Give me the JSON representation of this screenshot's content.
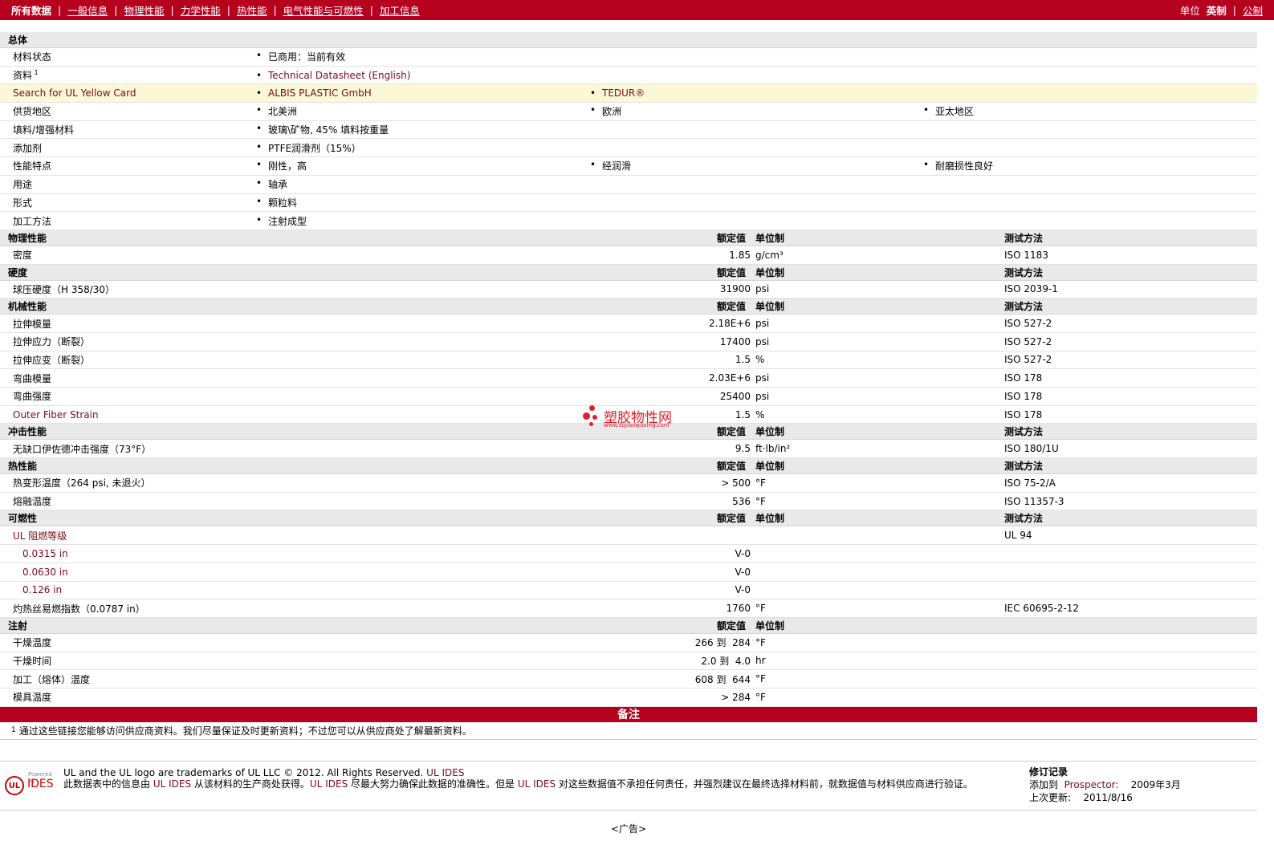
{
  "nav": {
    "items": [
      "所有数据",
      "一般信息",
      "物理性能",
      "力学性能",
      "热性能",
      "电气性能与可燃性",
      "加工信息"
    ],
    "units_label": "单位",
    "unit_current": "英制",
    "unit_other": "公制"
  },
  "general": {
    "title": "总体",
    "rows": [
      {
        "label": "材料状态",
        "values": [
          "已商用：当前有效"
        ]
      },
      {
        "label": "资料",
        "sup": "1",
        "values": [
          "Technical Datasheet (English)"
        ],
        "link": true
      },
      {
        "label": "Search for UL Yellow Card",
        "values": [
          "ALBIS PLASTIC GmbH",
          "TEDUR®"
        ],
        "link": true,
        "highlight": true
      },
      {
        "label": "供货地区",
        "values": [
          "北美洲",
          "欧洲",
          "亚太地区"
        ]
      },
      {
        "label": "填料/增强材料",
        "values": [
          "玻璃\\矿物, 45% 填料按重量"
        ]
      },
      {
        "label": "添加剂",
        "values": [
          "PTFE润滑剂（15%）"
        ]
      },
      {
        "label": "性能特点",
        "values": [
          "刚性，高",
          "经润滑",
          "耐磨损性良好"
        ]
      },
      {
        "label": "用途",
        "values": [
          "轴承"
        ]
      },
      {
        "label": "形式",
        "values": [
          "颗粒料"
        ]
      },
      {
        "label": "加工方法",
        "values": [
          "注射成型"
        ]
      }
    ]
  },
  "headers": {
    "nominal": "额定值",
    "unit": "单位制",
    "method": "测试方法"
  },
  "sections": [
    {
      "title": "物理性能",
      "method_header": true,
      "rows": [
        {
          "label": "密度",
          "value": "1.85",
          "unit": "g/cm³",
          "method": "ISO 1183"
        }
      ]
    },
    {
      "title": "硬度",
      "method_header": true,
      "rows": [
        {
          "label": "球压硬度（H 358/30）",
          "value": "31900",
          "unit": "psi",
          "method": "ISO 2039-1"
        }
      ]
    },
    {
      "title": "机械性能",
      "method_header": true,
      "rows": [
        {
          "label": "拉伸模量",
          "value": "2.18E+6",
          "unit": "psi",
          "method": "ISO 527-2"
        },
        {
          "label": "拉伸应力（断裂）",
          "value": "17400",
          "unit": "psi",
          "method": "ISO 527-2"
        },
        {
          "label": "拉伸应变（断裂）",
          "value": "1.5",
          "unit": "%",
          "method": "ISO 527-2"
        },
        {
          "label": "弯曲模量",
          "value": "2.03E+6",
          "unit": "psi",
          "method": "ISO 178"
        },
        {
          "label": "弯曲强度",
          "value": "25400",
          "unit": "psi",
          "method": "ISO 178"
        },
        {
          "label": "Outer Fiber Strain",
          "value": "1.5",
          "unit": "%",
          "method": "ISO 178",
          "link": true
        }
      ]
    },
    {
      "title": "冲击性能",
      "method_header": true,
      "rows": [
        {
          "label": "无缺口伊佐德冲击强度（73°F）",
          "value": "9.5",
          "unit": "ft·lb/in²",
          "method": "ISO 180/1U"
        }
      ]
    },
    {
      "title": "热性能",
      "method_header": true,
      "rows": [
        {
          "label": "热变形温度（264 psi, 未退火）",
          "value": "> 500",
          "unit": "°F",
          "method": "ISO 75-2/A"
        },
        {
          "label": "熔融温度",
          "value": "536",
          "unit": "°F",
          "method": "ISO 11357-3"
        }
      ]
    },
    {
      "title": "可燃性",
      "method_header": true,
      "rows": [
        {
          "label": "UL 阻燃等级",
          "value": "",
          "unit": "",
          "method": "UL 94",
          "link": true
        },
        {
          "label": "0.0315 in",
          "value": "V-0",
          "unit": "",
          "method": "",
          "sub": true
        },
        {
          "label": "0.0630 in",
          "value": "V-0",
          "unit": "",
          "method": "",
          "sub": true
        },
        {
          "label": "0.126 in",
          "value": "V-0",
          "unit": "",
          "method": "",
          "sub": true
        },
        {
          "label": "灼热丝易燃指数（0.0787 in）",
          "value": "1760",
          "unit": "°F",
          "method": "IEC 60695-2-12"
        }
      ]
    },
    {
      "title": "注射",
      "method_header": false,
      "rows": [
        {
          "label": "干燥温度",
          "value": "266 到  284",
          "unit": "°F",
          "method": ""
        },
        {
          "label": "干燥时间",
          "value": "2.0 到  4.0",
          "unit": "hr",
          "method": ""
        },
        {
          "label": "加工（熔体）温度",
          "value": "608 到  644",
          "unit": "°F",
          "method": ""
        },
        {
          "label": "模具温度",
          "value": "> 284",
          "unit": "°F",
          "method": ""
        }
      ]
    }
  ],
  "notes": {
    "title": "备注",
    "sup": "1",
    "text": "通过这些链接您能够访问供应商资料。我们尽量保证及时更新资料；不过您可以从供应商处了解最新资料。"
  },
  "footer": {
    "powered": "Powered by",
    "ul": "UL",
    "ides": "IDES",
    "line1_pre": "UL and the UL logo are trademarks of UL LLC © 2012. All Rights Reserved. ",
    "line1_link": "UL IDES",
    "line2_a": "此数据表中的信息由 ",
    "line2_b": "UL IDES",
    "line2_c": " 从该材料的生产商处获得。",
    "line2_d": "UL IDES",
    "line2_e": " 尽最大努力确保此数据的准确性。但是 ",
    "line2_f": "UL IDES",
    "line2_g": " 对这些数据值不承担任何责任，并强烈建议在最终选择材料前，就数据值与材料供应商进行验证。",
    "rev_title": "修订记录",
    "rev_added_label": "添加到",
    "rev_added_link": "Prospector:",
    "rev_added_date": "2009年3月",
    "rev_updated_label": "上次更新:",
    "rev_updated_date": "2011/8/16"
  },
  "watermark": {
    "text": "塑胶物性网",
    "url": "www.sujiaowuxing.com"
  },
  "ad": "<广告>"
}
